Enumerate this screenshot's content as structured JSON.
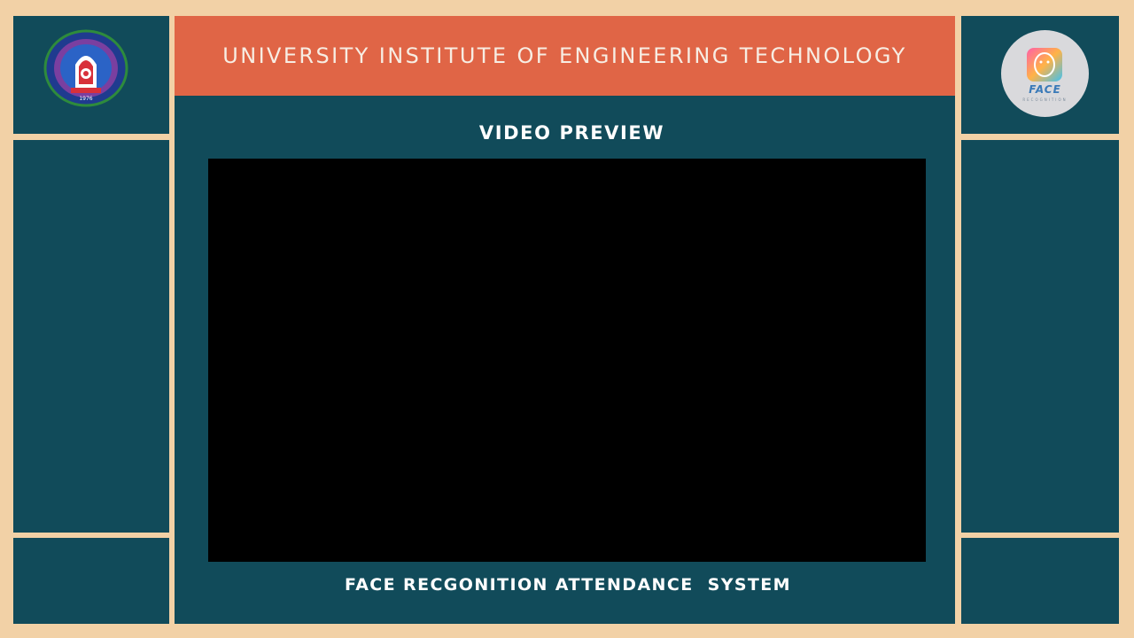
{
  "header": {
    "title": "UNIVERSITY INSTITUTE OF ENGINEERING TECHNOLOGY"
  },
  "main": {
    "preview_heading": "VIDEO PREVIEW",
    "footer_title": "FACE RECGONITION ATTENDANCE  SYSTEM"
  },
  "logos": {
    "left_icon": "university-emblem-icon",
    "left_year": "1976",
    "right_icon": "face-recognition-logo-icon",
    "right_word": "FACE",
    "right_subword": "RECOGNITION"
  },
  "colors": {
    "background": "#f2d1a6",
    "panel": "#114b5a",
    "header_bar": "#e06546",
    "video": "#000000",
    "text_light": "#ffffff"
  }
}
